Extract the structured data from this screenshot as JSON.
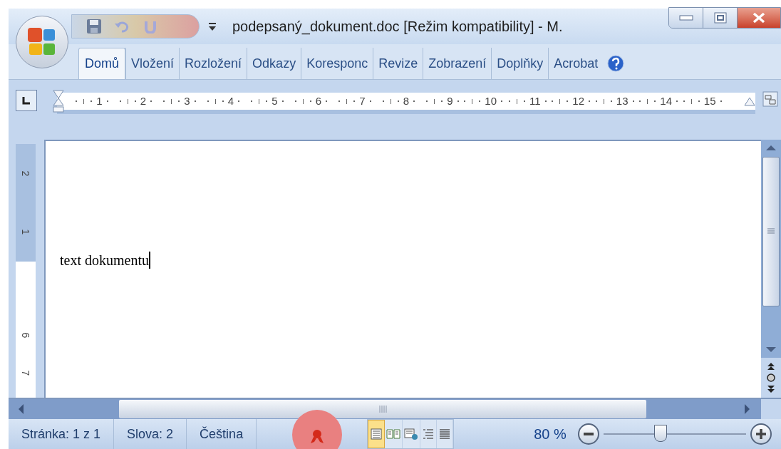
{
  "window": {
    "title": "podepsaný_dokument.doc [Režim kompatibility] - M."
  },
  "tabs": [
    {
      "label": "Domů",
      "selected": true
    },
    {
      "label": "Vložení",
      "selected": false
    },
    {
      "label": "Rozložení",
      "selected": false
    },
    {
      "label": "Odkazy",
      "selected": false
    },
    {
      "label": "Koresponc",
      "selected": false
    },
    {
      "label": "Revize",
      "selected": false
    },
    {
      "label": "Zobrazení",
      "selected": false
    },
    {
      "label": "Doplňky",
      "selected": false
    },
    {
      "label": "Acrobat",
      "selected": false
    }
  ],
  "ruler": {
    "horizontal": [
      "1",
      "2",
      "3",
      "4",
      "5",
      "6",
      "7",
      "8",
      "9",
      "10",
      "11",
      "12",
      "13",
      "14",
      "15"
    ],
    "vertical": [
      "2",
      "1",
      "6",
      "7"
    ]
  },
  "document": {
    "text": "text dokumentu"
  },
  "status_bar": {
    "items": [
      "Stránka: 1 z 1",
      "Slova: 2",
      "Čeština"
    ],
    "views": [
      {
        "kind": "print",
        "selected": true
      },
      {
        "kind": "reading",
        "selected": false
      },
      {
        "kind": "web",
        "selected": false
      },
      {
        "kind": "outline",
        "selected": false
      },
      {
        "kind": "draft",
        "selected": false
      }
    ],
    "zoom": "80 %",
    "zoom_slider": {
      "level": 0.4
    }
  }
}
